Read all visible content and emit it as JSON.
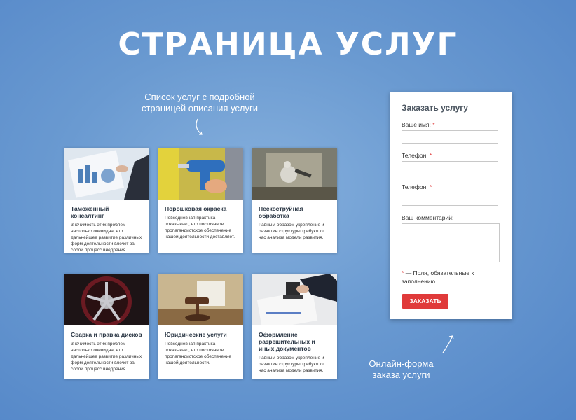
{
  "title": "СТРАНИЦА УСЛУГ",
  "callouts": {
    "list": "Список услуг с подробной страницей описания услуги",
    "form": "Онлайн-форма заказа услуги"
  },
  "services": [
    {
      "title": "Таможенный консалтинг",
      "text": "Значимость этих проблем настолько очевидна, что дальнейшее развитие различных форм деятельности влечет за собой процесс внедрения."
    },
    {
      "title": "Порошковая окраска",
      "text": "Повседневная практика показывает, что постоянное пропагандистское обеспечение нашей деятельности доставляет."
    },
    {
      "title": "Пескоструйная обработка",
      "text": "Равным образом укрепление и развитие структуры требуют от нас анализа модели развития."
    },
    {
      "title": "Сварка и правка дисков",
      "text": "Значимость этих проблем настолько очевидна, что дальнейшее развитие различных форм деятельности влечет за собой процесс внедрения."
    },
    {
      "title": "Юридические услуги",
      "text": "Повседневная практика показывает, что постоянное пропагандистское обеспечение нашей деятельности."
    },
    {
      "title": "Оформление разрешительных и иных документов",
      "text": "Равным образом укрепление и развитие структуры требуют от нас анализа модели развития."
    }
  ],
  "form": {
    "title": "Заказать услугу",
    "name_label": "Ваше имя:",
    "phone_label": "Телефон:",
    "phone2_label": "Телефон:",
    "comment_label": "Ваш комментарий:",
    "required_mark": "*",
    "note": "— Поля, обязательные к заполнению.",
    "submit_label": "ЗАКАЗАТЬ"
  }
}
